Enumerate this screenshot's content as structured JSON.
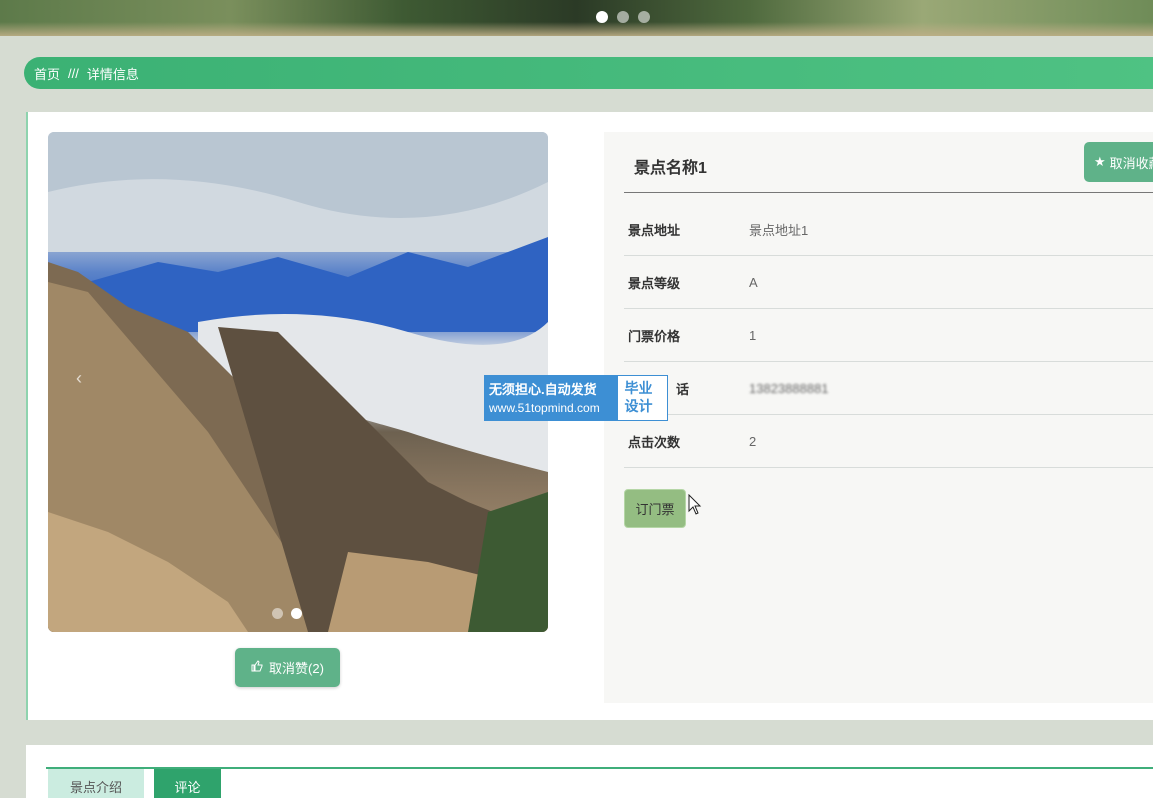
{
  "banner": {
    "slides": 3,
    "active": 0
  },
  "breadcrumb": {
    "home": "首页",
    "separator": "///",
    "current": "详情信息"
  },
  "gallery": {
    "slides": 2,
    "active": 1,
    "prev_icon": "‹"
  },
  "like_button": {
    "label": "取消赞(2)",
    "icon": "thumbs-up-icon"
  },
  "details": {
    "title": "景点名称1",
    "favorite_button": {
      "label": "取消收藏",
      "icon": "star-icon"
    },
    "rows": [
      {
        "label": "景点地址",
        "value": "景点地址1"
      },
      {
        "label": "景点等级",
        "value": "A"
      },
      {
        "label": "门票价格",
        "value": "1"
      },
      {
        "label": "话",
        "value": "13823888881"
      },
      {
        "label": "点击次数",
        "value": "2"
      }
    ],
    "book_button": "订门票"
  },
  "watermark": {
    "line1": "无须担心.自动发货",
    "line2": "www.51topmind.com",
    "badge1": "毕业",
    "badge2": "设计"
  },
  "tabs": [
    {
      "label": "景点介绍"
    },
    {
      "label": "评论"
    }
  ],
  "colors": {
    "accent": "#3bb174",
    "button": "#5fb289",
    "book": "#94bd82",
    "watermark": "#3d8fd4"
  }
}
